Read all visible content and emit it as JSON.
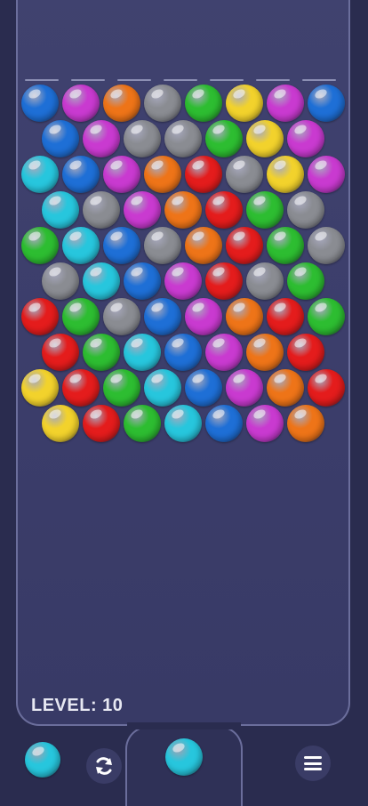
{
  "level": {
    "label": "LEVEL: 10"
  },
  "palette": {
    "blue": "#1e6fd6",
    "magenta": "#c93ad0",
    "orange": "#ee7418",
    "gray": "#8a8c92",
    "green": "#2dbd31",
    "yellow": "#f2d22c",
    "cyan": "#27c6dd",
    "red": "#e41c1c"
  },
  "grid": {
    "rows": [
      [
        "blue",
        "magenta",
        "orange",
        "gray",
        "green",
        "yellow",
        "magenta",
        "blue"
      ],
      [
        "blue",
        "magenta",
        "gray",
        "gray",
        "green",
        "yellow",
        "magenta"
      ],
      [
        "cyan",
        "blue",
        "magenta",
        "orange",
        "red",
        "gray",
        "yellow",
        "magenta"
      ],
      [
        "cyan",
        "gray",
        "magenta",
        "orange",
        "red",
        "green",
        "gray"
      ],
      [
        "green",
        "cyan",
        "blue",
        "gray",
        "orange",
        "red",
        "green",
        "gray"
      ],
      [
        "gray",
        "cyan",
        "blue",
        "magenta",
        "red",
        "gray",
        "green"
      ],
      [
        "red",
        "green",
        "gray",
        "blue",
        "magenta",
        "orange",
        "red",
        "green"
      ],
      [
        "red",
        "green",
        "cyan",
        "blue",
        "magenta",
        "orange",
        "red"
      ],
      [
        "yellow",
        "red",
        "green",
        "cyan",
        "blue",
        "magenta",
        "orange",
        "red"
      ],
      [
        "yellow",
        "red",
        "green",
        "cyan",
        "blue",
        "magenta",
        "orange"
      ]
    ]
  },
  "shooter": {
    "current": "cyan",
    "next": "cyan"
  },
  "icons": {
    "refresh": "refresh-icon",
    "menu": "menu-icon"
  }
}
